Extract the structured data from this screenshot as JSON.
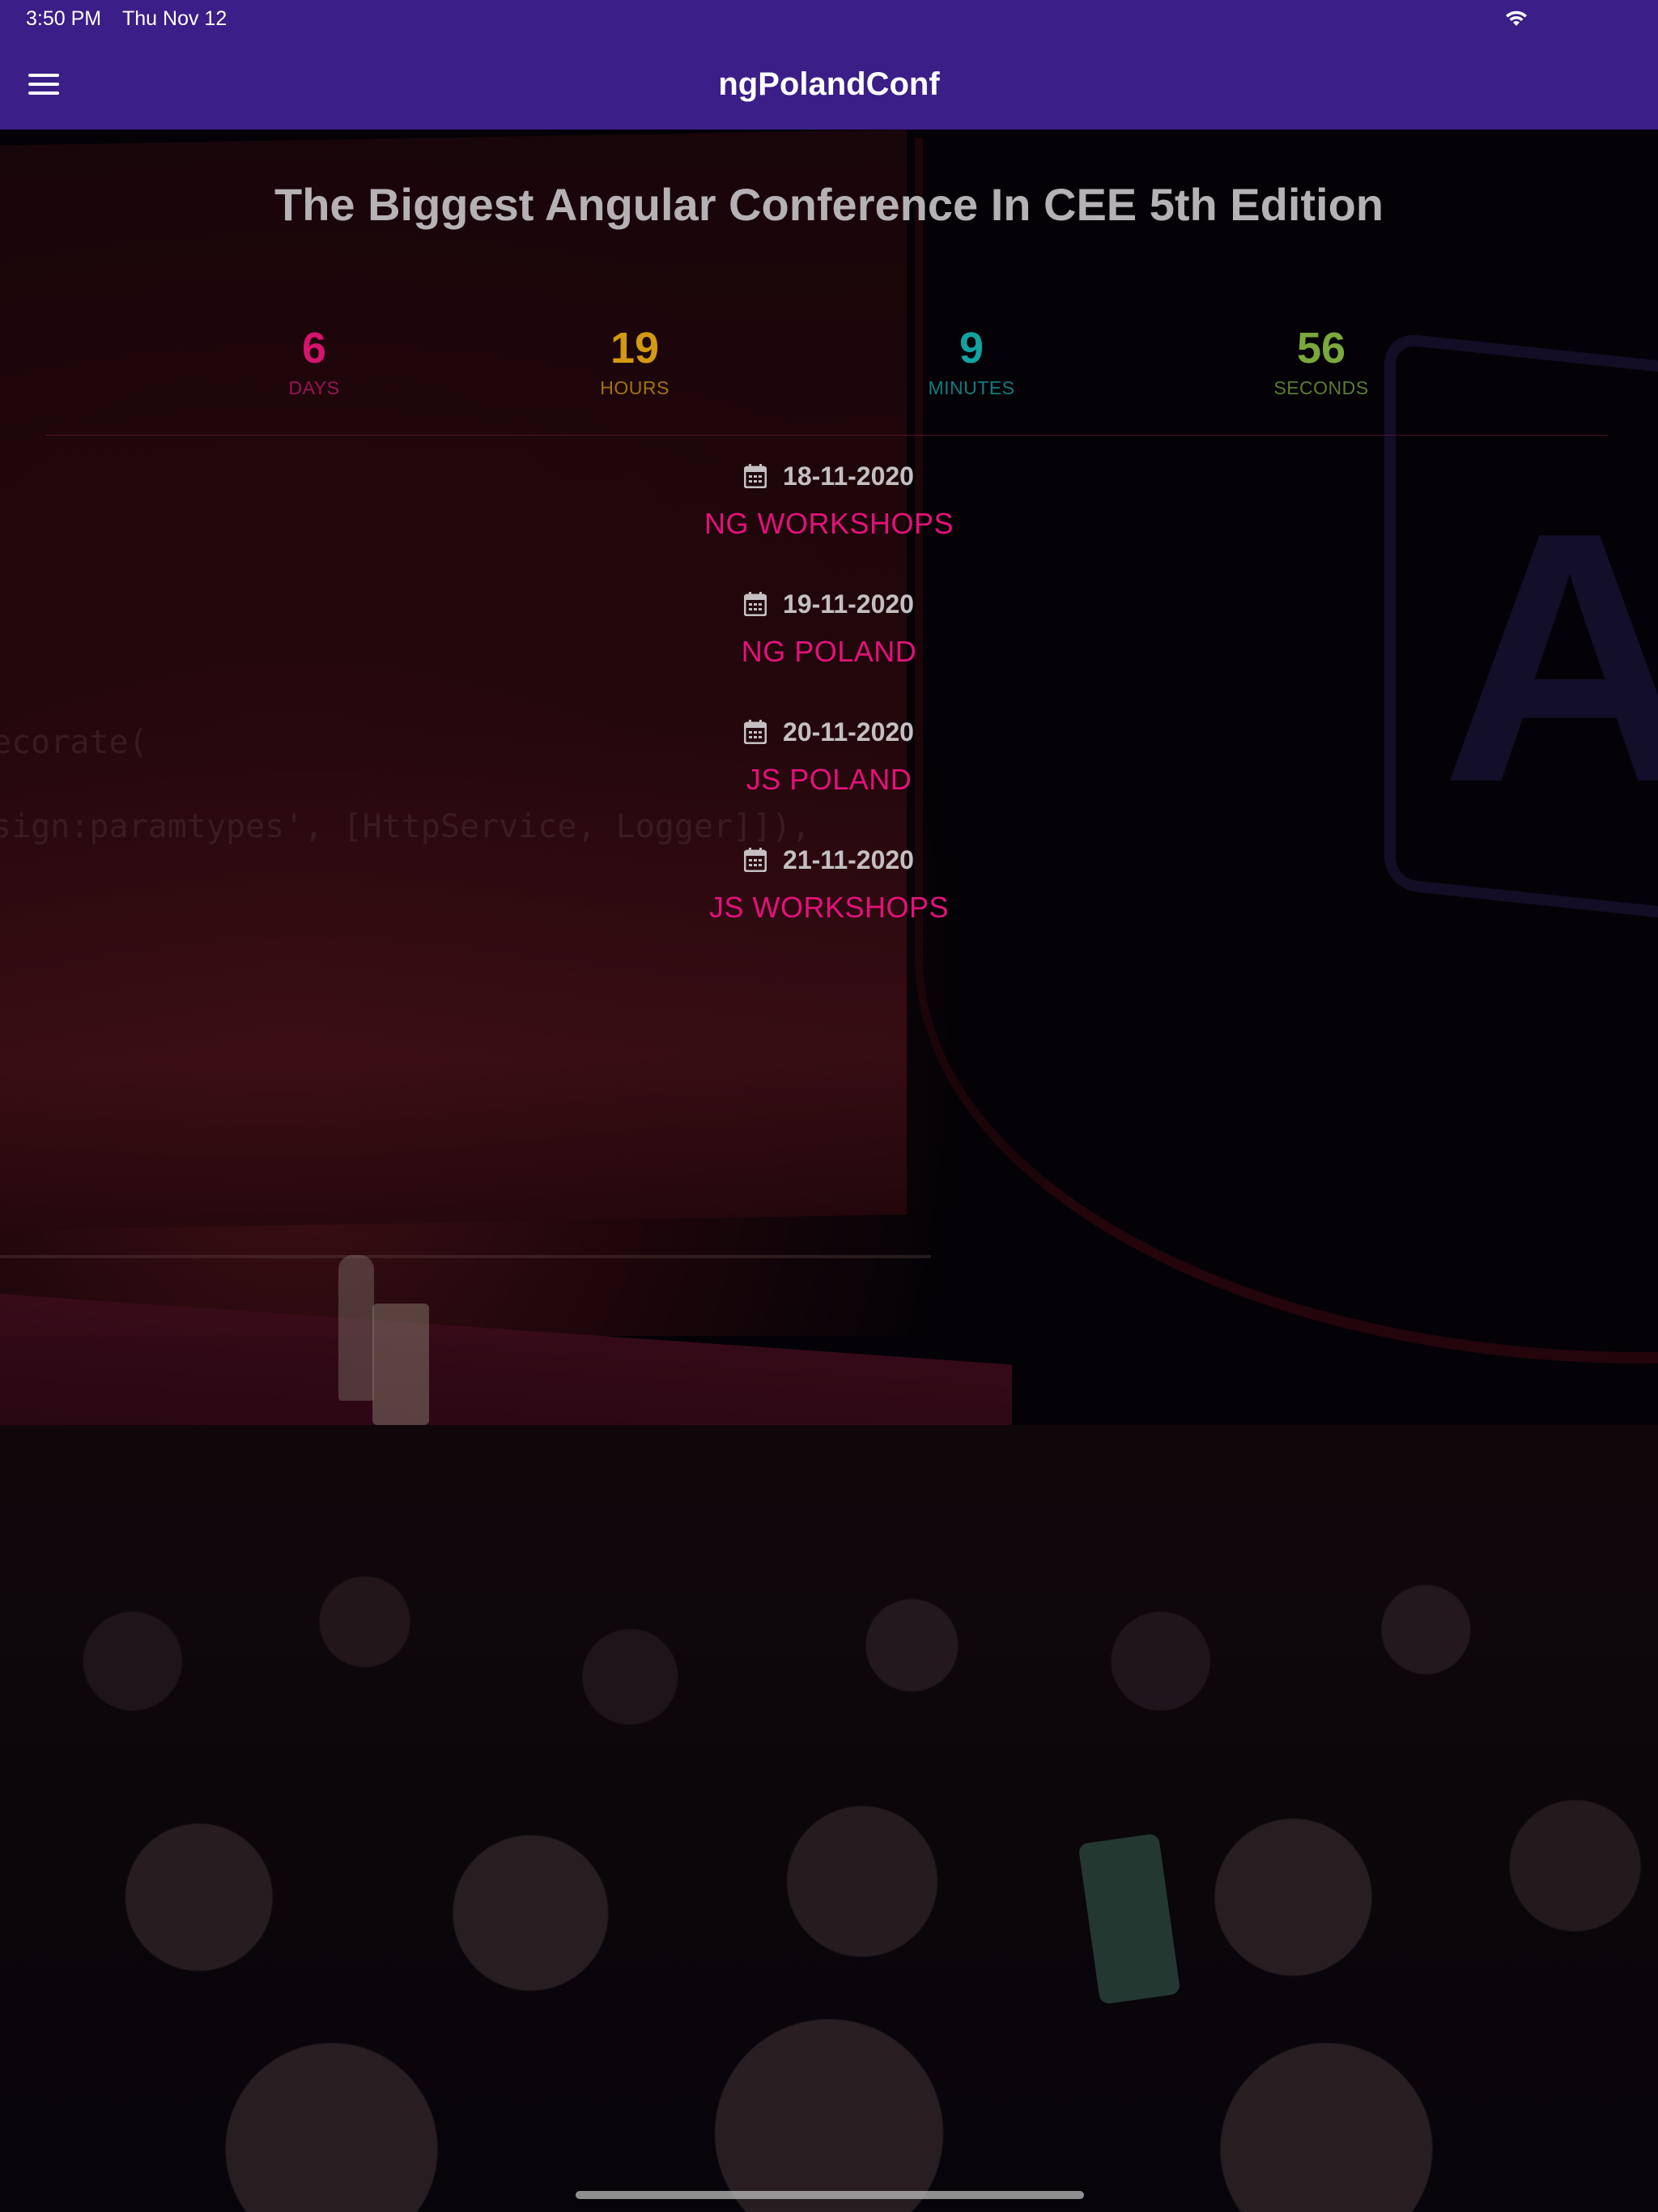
{
  "status_bar": {
    "time": "3:50 PM",
    "date": "Thu Nov 12",
    "wifi_icon": "wifi-icon"
  },
  "app_bar": {
    "menu_icon": "hamburger-menu-icon",
    "title": "ngPolandConf",
    "background_color": "#3b1e87"
  },
  "hero": {
    "headline": "The Biggest Angular Conference In CEE 5th Edition"
  },
  "countdown": [
    {
      "value": "6",
      "label": "DAYS",
      "color": "#d4146f",
      "label_color": "#9a1456"
    },
    {
      "value": "19",
      "label": "HOURS",
      "color": "#d29a12",
      "label_color": "#a17414"
    },
    {
      "value": "9",
      "label": "MINUTES",
      "color": "#12a2a2",
      "label_color": "#147b80"
    },
    {
      "value": "56",
      "label": "SECONDS",
      "color": "#7ba83c",
      "label_color": "#5c7b33"
    }
  ],
  "events": [
    {
      "date": "18-11-2020",
      "name": "NG WORKSHOPS"
    },
    {
      "date": "19-11-2020",
      "name": "NG POLAND"
    },
    {
      "date": "20-11-2020",
      "name": "JS POLAND"
    },
    {
      "date": "21-11-2020",
      "name": "JS WORKSHOPS"
    }
  ],
  "colors": {
    "accent": "#e3127a",
    "event_date_text": "#c4bfc2",
    "headline_text": "#b5b1b4"
  },
  "background": {
    "code_lines": [
      "ecorate(",
      "sign:paramtypes', [HttpService, Logger]]),"
    ],
    "logo_letter": "A"
  }
}
